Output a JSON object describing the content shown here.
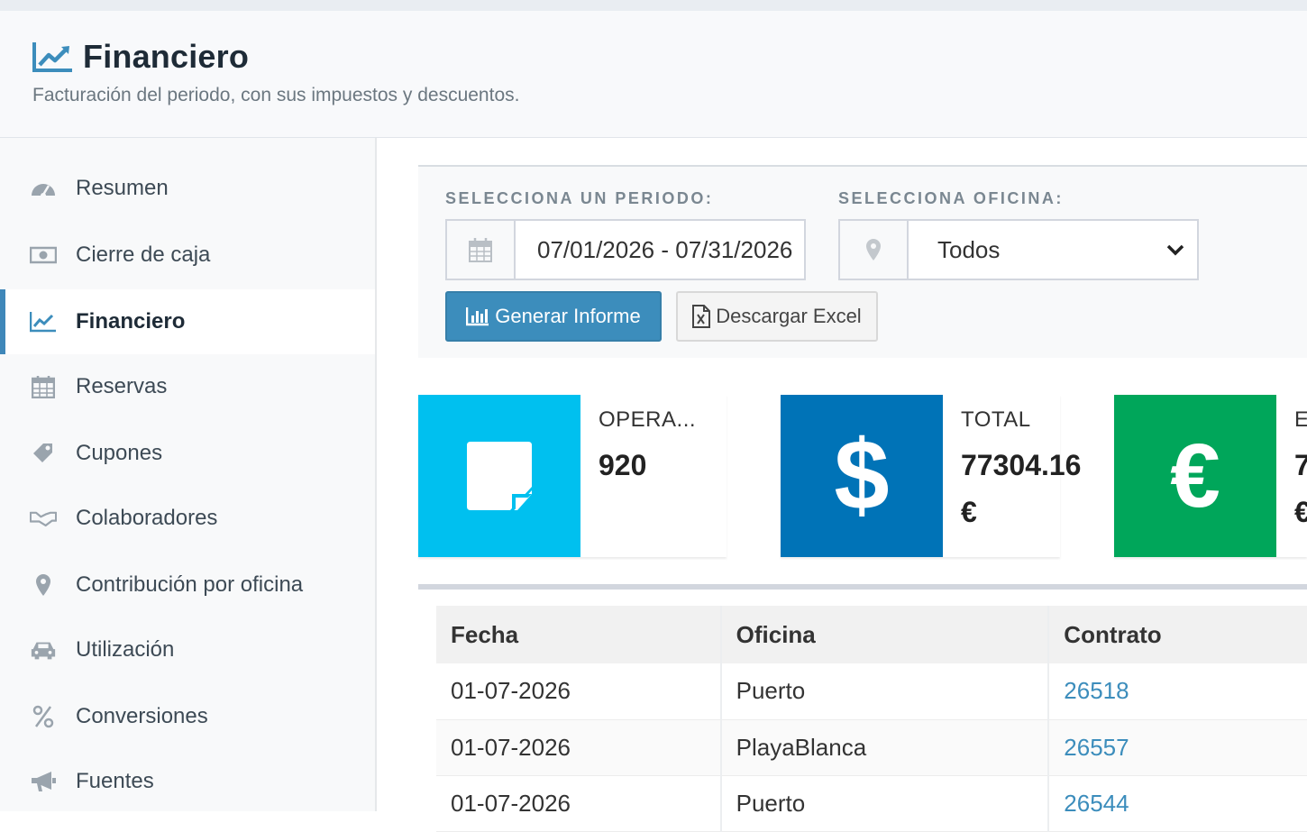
{
  "header": {
    "title": "Financiero",
    "subtitle": "Facturación del periodo, con sus impuestos y descuentos.",
    "icon": "line-chart-icon"
  },
  "sidebar": {
    "items": [
      {
        "label": "Resumen",
        "icon": "dashboard-icon",
        "active": false
      },
      {
        "label": "Cierre de caja",
        "icon": "money-icon",
        "active": false
      },
      {
        "label": "Financiero",
        "icon": "line-chart-icon",
        "active": true
      },
      {
        "label": "Reservas",
        "icon": "calendar-icon",
        "active": false
      },
      {
        "label": "Cupones",
        "icon": "tag-icon",
        "active": false
      },
      {
        "label": "Colaboradores",
        "icon": "handshake-icon",
        "active": false
      },
      {
        "label": "Contribución por oficina",
        "icon": "map-marker-icon",
        "active": false
      },
      {
        "label": "Utilización",
        "icon": "car-icon",
        "active": false
      },
      {
        "label": "Conversiones",
        "icon": "percent-icon",
        "active": false
      },
      {
        "label": "Fuentes",
        "icon": "bullhorn-icon",
        "active": false
      }
    ]
  },
  "filters": {
    "period_label": "SELECCIONA UN PERIODO:",
    "period_value": "07/01/2026 - 07/31/2026",
    "office_label": "SELECCIONA OFICINA:",
    "office_value": "Todos",
    "generate_button": "Generar Informe",
    "excel_button": "Descargar Excel"
  },
  "info_boxes": [
    {
      "label": "OPERA...",
      "value": "920",
      "color": "#00c0ef",
      "icon": "sticky-note-icon"
    },
    {
      "label": "TOTAL",
      "value": "77304.16",
      "unit": "€",
      "color": "#0073b7",
      "icon": "dollar-icon"
    },
    {
      "label": "E",
      "value": "7",
      "unit": "€",
      "color": "#00a65a",
      "icon": "euro-icon"
    }
  ],
  "table": {
    "columns": [
      "Fecha",
      "Oficina",
      "Contrato"
    ],
    "rows": [
      [
        "01-07-2026",
        "Puerto",
        "26518"
      ],
      [
        "01-07-2026",
        "PlayaBlanca",
        "26557"
      ],
      [
        "01-07-2026",
        "Puerto",
        "26544"
      ]
    ]
  },
  "colors": {
    "accent": "#3c8dbc",
    "info_cyan": "#00c0ef",
    "info_blue": "#0073b7",
    "info_green": "#00a65a"
  }
}
